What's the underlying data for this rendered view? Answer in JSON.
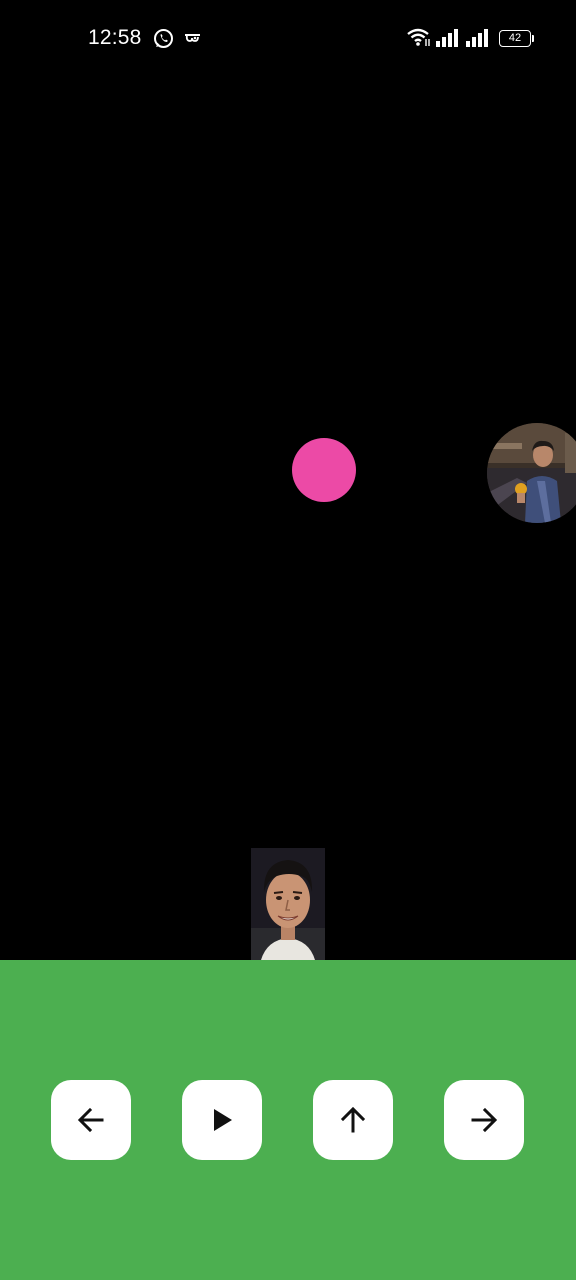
{
  "status_bar": {
    "time": "12:58",
    "battery_level": "42",
    "icons": [
      "whatsapp-icon",
      "notification-icon",
      "wifi-icon",
      "signal-icon",
      "signal-icon",
      "battery-icon"
    ]
  },
  "game": {
    "ball_color": "#ec4aa6",
    "background_color": "#000000",
    "controls_background": "#4caf50",
    "enemy": "avatar-photo-circle",
    "player": "avatar-photo-rect"
  },
  "controls": [
    {
      "name": "left-arrow-icon"
    },
    {
      "name": "play-icon"
    },
    {
      "name": "up-arrow-icon"
    },
    {
      "name": "right-arrow-icon"
    }
  ]
}
